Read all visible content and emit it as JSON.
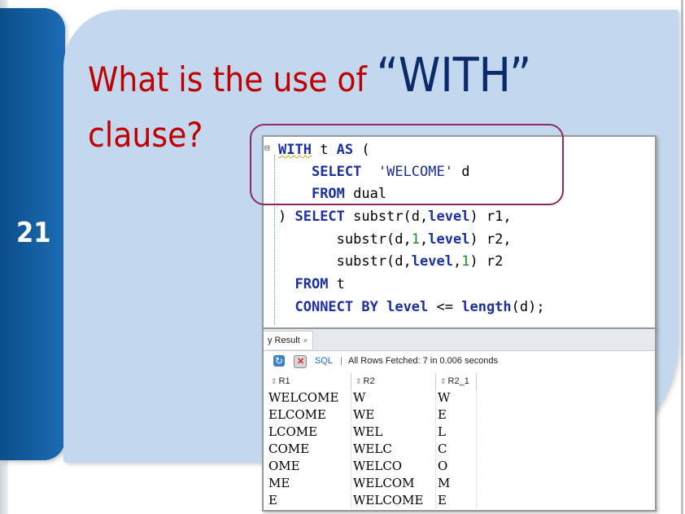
{
  "slide": {
    "number": "21",
    "title_prefix": "What is the use of ",
    "title_keyword": "“WITH”",
    "title_line2": "clause?"
  },
  "code": {
    "lines": [
      [
        {
          "t": "WITH",
          "c": "kwd",
          "sq": true
        },
        {
          "t": " t ",
          "c": "plain"
        },
        {
          "t": "AS",
          "c": "kwd"
        },
        {
          "t": " (",
          "c": "plain"
        }
      ],
      [
        {
          "t": "    ",
          "c": "plain"
        },
        {
          "t": "SELECT",
          "c": "kwd"
        },
        {
          "t": "  ",
          "c": "plain"
        },
        {
          "t": "'WELCOME'",
          "c": "str"
        },
        {
          "t": " d",
          "c": "plain"
        }
      ],
      [
        {
          "t": "    ",
          "c": "plain"
        },
        {
          "t": "FROM",
          "c": "kwd"
        },
        {
          "t": " dual",
          "c": "plain"
        }
      ],
      [
        {
          "t": ") ",
          "c": "plain"
        },
        {
          "t": "SELECT",
          "c": "kwd"
        },
        {
          "t": " substr(d,",
          "c": "plain"
        },
        {
          "t": "level",
          "c": "kwd"
        },
        {
          "t": ") r1,",
          "c": "plain"
        }
      ],
      [
        {
          "t": "       substr(d,",
          "c": "plain"
        },
        {
          "t": "1",
          "c": "num"
        },
        {
          "t": ",",
          "c": "plain"
        },
        {
          "t": "level",
          "c": "kwd"
        },
        {
          "t": ") r2,",
          "c": "plain"
        }
      ],
      [
        {
          "t": "       substr(d,",
          "c": "plain"
        },
        {
          "t": "level",
          "c": "kwd"
        },
        {
          "t": ",",
          "c": "plain"
        },
        {
          "t": "1",
          "c": "num"
        },
        {
          "t": ") r2",
          "c": "plain"
        }
      ],
      [
        {
          "t": "  ",
          "c": "plain"
        },
        {
          "t": "FROM",
          "c": "kwd"
        },
        {
          "t": " t",
          "c": "plain"
        }
      ],
      [
        {
          "t": "  ",
          "c": "plain"
        },
        {
          "t": "CONNECT BY",
          "c": "kwd"
        },
        {
          "t": " ",
          "c": "plain"
        },
        {
          "t": "level",
          "c": "kwd"
        },
        {
          "t": " <= ",
          "c": "plain"
        },
        {
          "t": "length",
          "c": "kwd"
        },
        {
          "t": "(d);",
          "c": "plain"
        }
      ]
    ]
  },
  "result": {
    "tab_label": "y Result",
    "tab_close": "×",
    "sql_label": "SQL",
    "separator": "|",
    "status": "All Rows Fetched: 7 in 0.006 seconds",
    "columns": [
      "R1",
      "R2",
      "R2_1"
    ],
    "rows": [
      [
        "WELCOME",
        "W",
        "W"
      ],
      [
        "ELCOME",
        "WE",
        "E"
      ],
      [
        "LCOME",
        "WEL",
        "L"
      ],
      [
        "COME",
        "WELC",
        "C"
      ],
      [
        "OME",
        "WELCO",
        "O"
      ],
      [
        "ME",
        "WELCOM",
        "M"
      ],
      [
        "E",
        "WELCOME",
        "E"
      ]
    ]
  },
  "colors": {
    "title_red": "#c00000",
    "title_navy": "#0b2a6a",
    "tab_blue": "#1c6cb5",
    "card_blue": "#c3d8ee",
    "highlight": "#8c2a5e"
  }
}
